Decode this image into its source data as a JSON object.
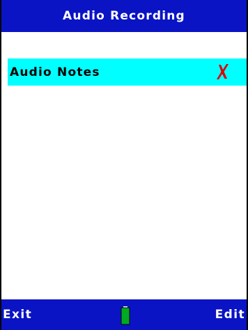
{
  "header": {
    "title": "Audio Recording"
  },
  "list": {
    "items": [
      {
        "label": "Audio Notes",
        "status_icon": "red-x-icon",
        "highlight_color": "#00ffff"
      }
    ]
  },
  "softkeys": {
    "left_label": "Exit",
    "right_label": "Edit",
    "center_icon": "battery-icon"
  },
  "colors": {
    "bar_background": "#0a14c4",
    "bar_text": "#ffffff",
    "highlight": "#00ffff",
    "status_icon": "#e00000",
    "battery_fill": "#00aa22"
  }
}
